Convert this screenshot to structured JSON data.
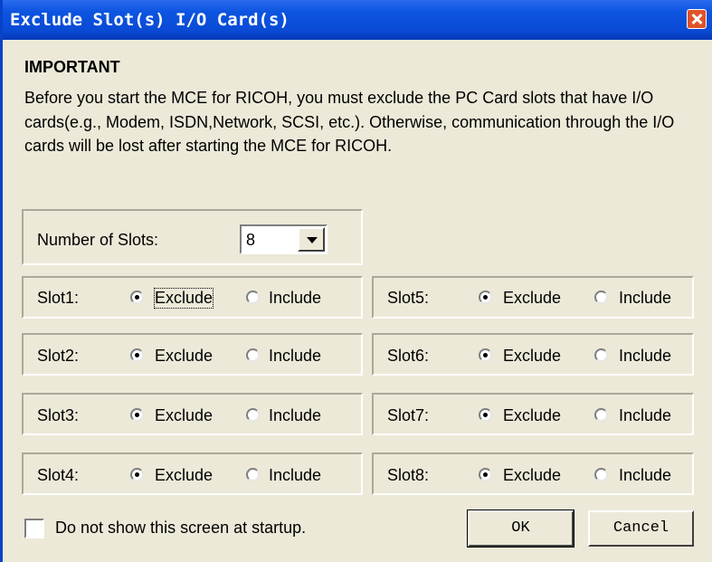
{
  "window": {
    "title": "Exclude Slot(s) I/O Card(s)"
  },
  "heading": "IMPORTANT",
  "description": "Before you start the MCE for RICOH, you must exclude the PC Card slots that have I/O cards(e.g., Modem, ISDN,Network, SCSI, etc.). Otherwise, communication through the I/O cards will be lost after starting the MCE for RICOH.",
  "slots_count": {
    "label": "Number of Slots:",
    "value": "8"
  },
  "options": {
    "exclude": "Exclude",
    "include": "Include"
  },
  "slots": [
    {
      "label": "Slot1:",
      "selected": "exclude"
    },
    {
      "label": "Slot2:",
      "selected": "exclude"
    },
    {
      "label": "Slot3:",
      "selected": "exclude"
    },
    {
      "label": "Slot4:",
      "selected": "exclude"
    },
    {
      "label": "Slot5:",
      "selected": "exclude"
    },
    {
      "label": "Slot6:",
      "selected": "exclude"
    },
    {
      "label": "Slot7:",
      "selected": "exclude"
    },
    {
      "label": "Slot8:",
      "selected": "exclude"
    }
  ],
  "startup_checkbox": {
    "label": "Do not show this screen at startup.",
    "checked": false
  },
  "buttons": {
    "ok": "OK",
    "cancel": "Cancel"
  }
}
